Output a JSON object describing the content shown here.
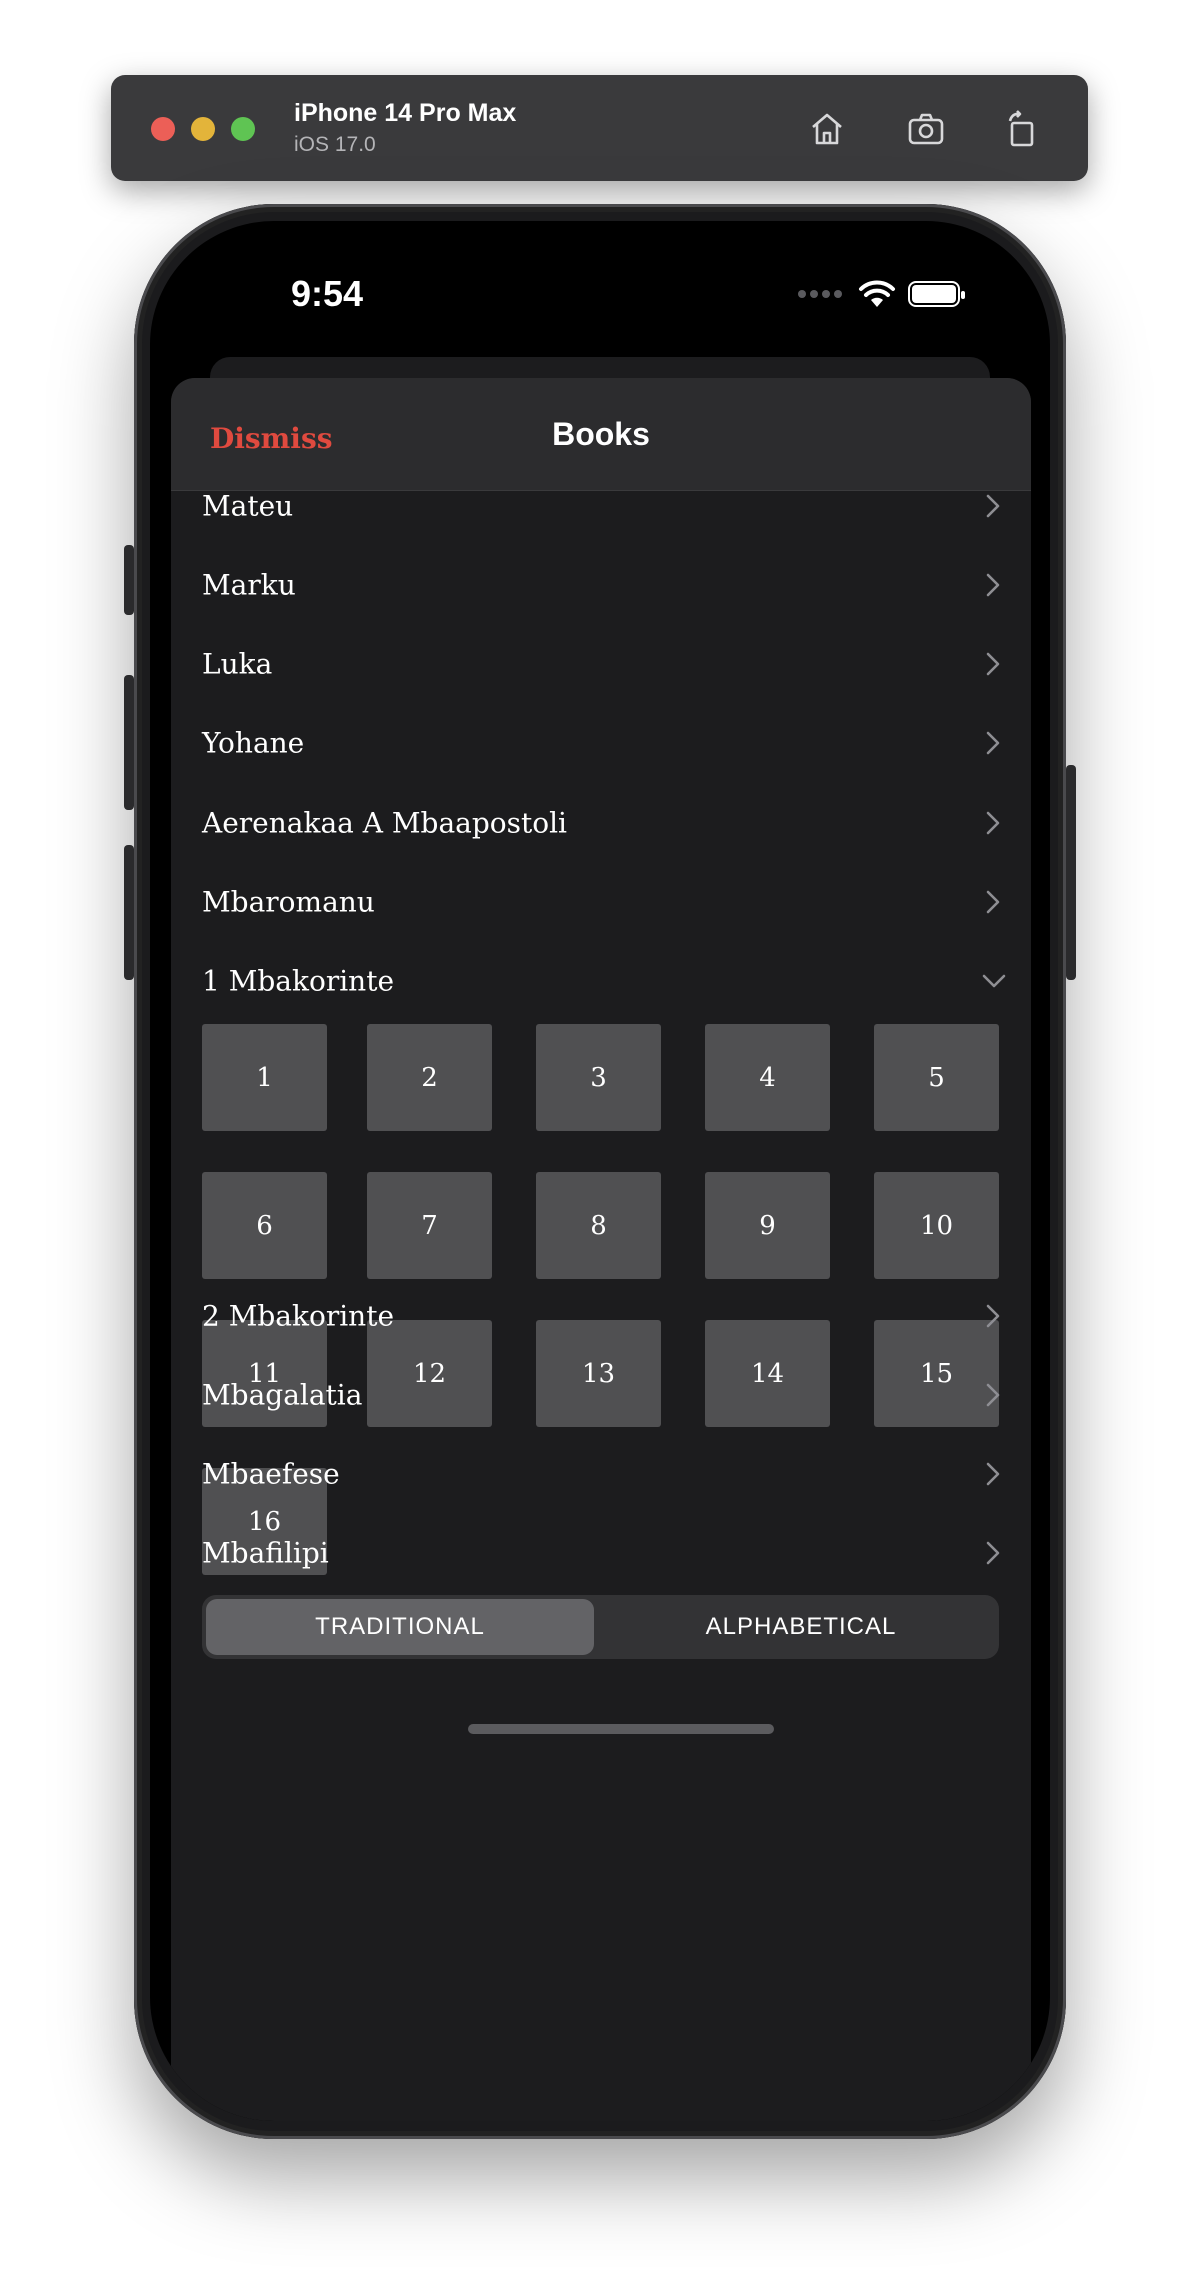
{
  "simulator": {
    "device_name": "iPhone 14 Pro Max",
    "os_version": "iOS 17.0",
    "icons": [
      "home-icon",
      "screenshot-icon",
      "rotate-icon"
    ]
  },
  "status_bar": {
    "time": "9:54",
    "icons": [
      "cellular-dots-icon",
      "wifi-icon",
      "battery-icon"
    ]
  },
  "header": {
    "dismiss_label": "Dismiss",
    "title": "Books",
    "accent_color": "#e04a3f"
  },
  "books_before": [
    {
      "name": "Mateu"
    },
    {
      "name": "Marku"
    },
    {
      "name": "Luka"
    },
    {
      "name": "Yohane"
    },
    {
      "name": "Aerenakaa A Mbaapostoli"
    },
    {
      "name": "Mbaromanu"
    }
  ],
  "expanded_book": {
    "name": "1 Mbakorinte",
    "chapters": [
      "1",
      "2",
      "3",
      "4",
      "5",
      "6",
      "7",
      "8",
      "9",
      "10",
      "11",
      "12",
      "13",
      "14",
      "15",
      "16"
    ]
  },
  "books_after": [
    {
      "name": "2 Mbakorinte"
    },
    {
      "name": "Mbagalatia"
    },
    {
      "name": "Mbaefese"
    },
    {
      "name": "Mbafilipi"
    }
  ],
  "segment": {
    "traditional": "TRADITIONAL",
    "alphabetical": "ALPHABETICAL",
    "selected": "TRADITIONAL"
  }
}
